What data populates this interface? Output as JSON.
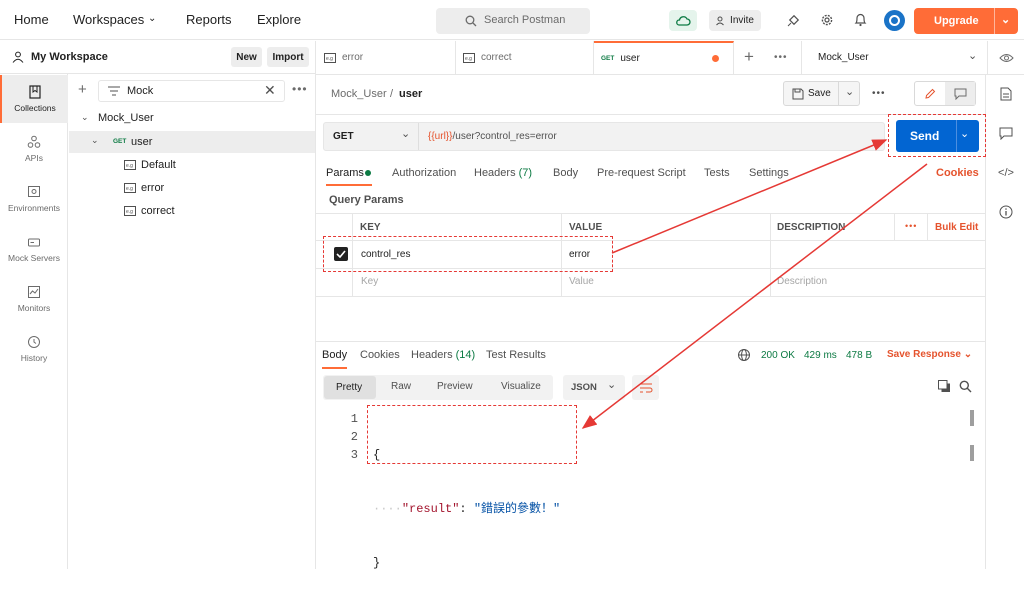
{
  "topbar": {
    "nav": [
      "Home",
      "Workspaces",
      "Reports",
      "Explore"
    ],
    "search_placeholder": "Search Postman",
    "invite": "Invite",
    "upgrade": "Upgrade"
  },
  "workspace": {
    "name": "My Workspace",
    "new": "New",
    "import": "Import"
  },
  "rail": [
    "Collections",
    "APIs",
    "Environments",
    "Mock Servers",
    "Monitors",
    "History"
  ],
  "sidebar": {
    "filter": "Mock",
    "collection": "Mock_User",
    "request_method": "GET",
    "request_name": "user",
    "examples": [
      "Default",
      "error",
      "correct"
    ]
  },
  "tabs": [
    {
      "label": "error"
    },
    {
      "label": "correct"
    },
    {
      "method": "GET",
      "label": "user"
    }
  ],
  "environment": "Mock_User",
  "breadcrumb": {
    "collection": "Mock_User",
    "separator": "/",
    "request": "user"
  },
  "save": "Save",
  "request": {
    "method": "GET",
    "url_var": "{{url}}",
    "url_rest": "/user?control_res=error",
    "send": "Send"
  },
  "param_tabs": {
    "params": "Params",
    "authorization": "Authorization",
    "headers": "Headers",
    "headers_count": "(7)",
    "body": "Body",
    "prerequest": "Pre-request Script",
    "tests": "Tests",
    "settings": "Settings",
    "cookies": "Cookies"
  },
  "query": {
    "title": "Query Params",
    "col_key": "KEY",
    "col_value": "VALUE",
    "col_desc": "DESCRIPTION",
    "bulk_edit": "Bulk Edit",
    "row_key": "control_res",
    "row_value": "error",
    "ph_key": "Key",
    "ph_value": "Value",
    "ph_desc": "Description"
  },
  "response": {
    "tabs": {
      "body": "Body",
      "cookies": "Cookies",
      "headers": "Headers",
      "headers_count": "(14)",
      "tests": "Test Results"
    },
    "status": "200 OK",
    "time": "429 ms",
    "size": "478 B",
    "save_response": "Save Response",
    "views": [
      "Pretty",
      "Raw",
      "Preview",
      "Visualize"
    ],
    "format": "JSON",
    "lines": [
      "1",
      "2",
      "3"
    ],
    "code_open": "{",
    "code_key": "\"result\"",
    "code_colon": ": ",
    "code_value": "\"錯誤的參數！\"",
    "code_close": "}"
  },
  "colors": {
    "accent": "#ff6c37",
    "send": "#0265d2",
    "ok": "#0c7a43",
    "annotation": "#e53935"
  }
}
